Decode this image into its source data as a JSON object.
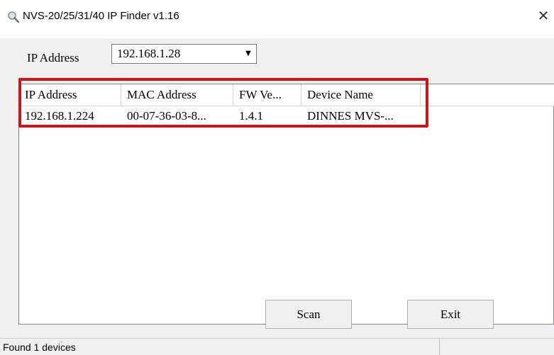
{
  "window": {
    "title": "NVS-20/25/31/40 IP Finder v1.16",
    "icon": "magnifier-icon",
    "close_symbol": "✕"
  },
  "ip_address": {
    "label": "IP Address",
    "selected": "192.168.1.28",
    "dropdown_arrow": "▼"
  },
  "device_list": {
    "columns": [
      "IP Address",
      "MAC Address",
      "FW Ve...",
      "Device Name"
    ],
    "rows": [
      [
        "192.168.1.224",
        "00-07-36-03-8...",
        "1.4.1",
        "DINNES MVS-..."
      ]
    ]
  },
  "buttons": {
    "scan": "Scan",
    "exit": "Exit"
  },
  "status": {
    "text": "Found 1 devices"
  },
  "colors": {
    "highlight_border": "#c8161d",
    "window_bg": "#f0f0f0"
  }
}
